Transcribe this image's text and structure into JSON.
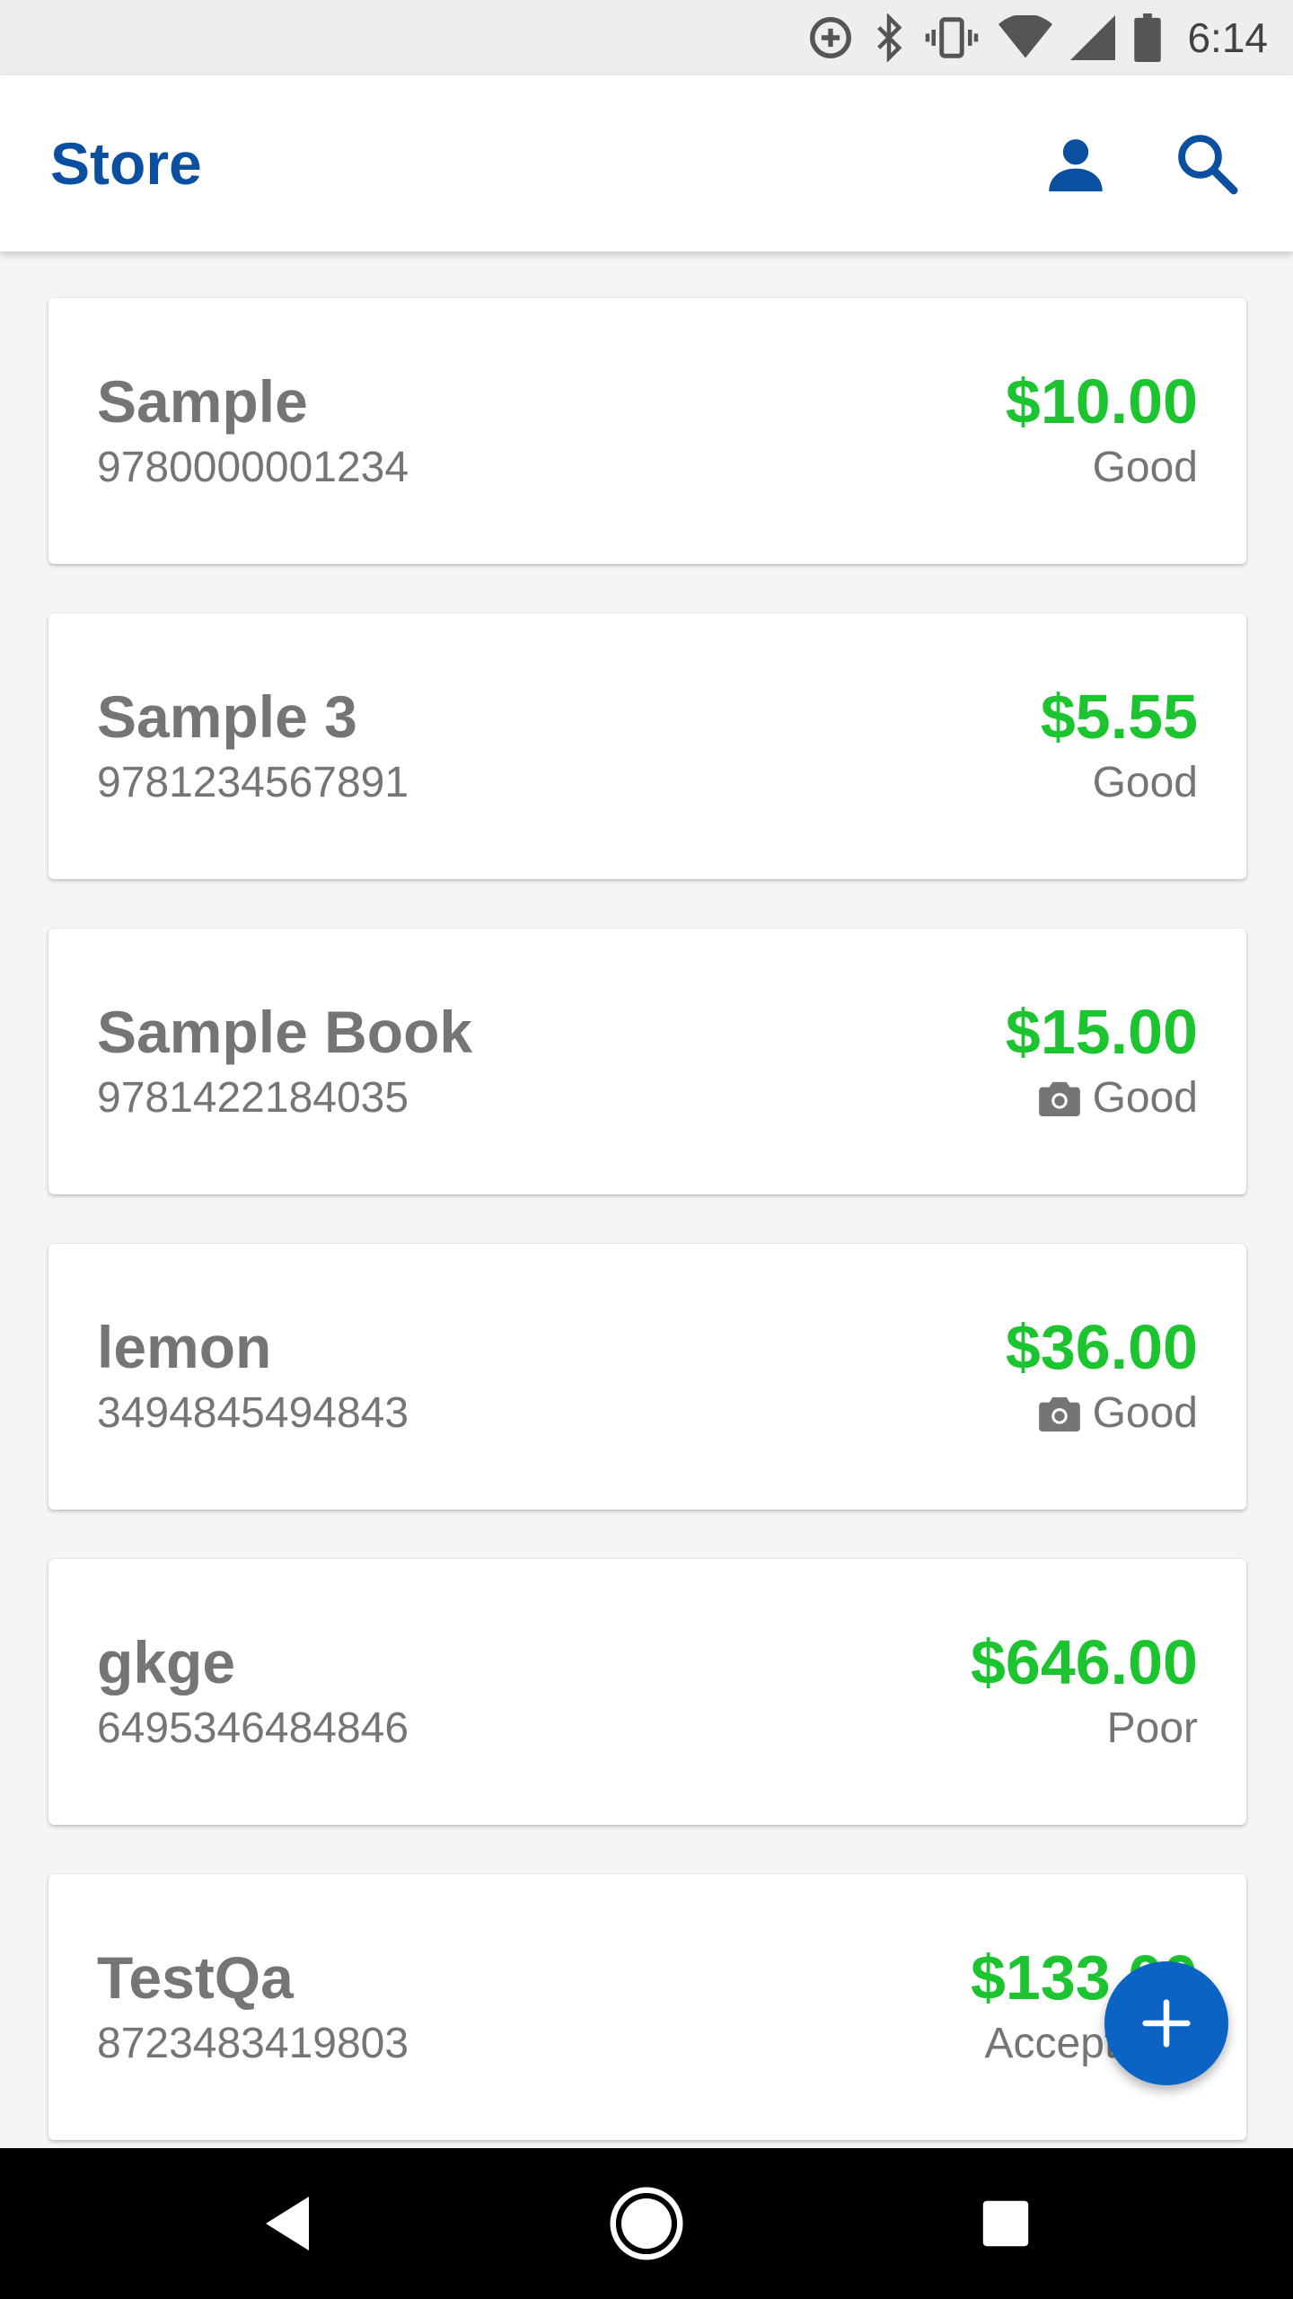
{
  "status_bar": {
    "time": "6:14",
    "icons": [
      "data-saver-icon",
      "bluetooth-icon",
      "vibrate-icon",
      "wifi-icon",
      "cell-signal-icon",
      "battery-icon"
    ]
  },
  "app_bar": {
    "title": "Store",
    "actions": [
      "account-icon",
      "search-icon"
    ]
  },
  "colors": {
    "accent": "#0b4fa0",
    "fab": "#0b63c3",
    "price": "#1cc42f",
    "text_secondary": "#757575"
  },
  "listings": [
    {
      "title": "Sample",
      "isbn": "9780000001234",
      "price": "$10.00",
      "condition": "Good",
      "has_photo": false
    },
    {
      "title": "Sample 3",
      "isbn": "9781234567891",
      "price": "$5.55",
      "condition": "Good",
      "has_photo": false
    },
    {
      "title": "Sample Book",
      "isbn": "9781422184035",
      "price": "$15.00",
      "condition": "Good",
      "has_photo": true
    },
    {
      "title": "lemon",
      "isbn": "3494845494843",
      "price": "$36.00",
      "condition": "Good",
      "has_photo": true
    },
    {
      "title": "gkge",
      "isbn": "6495346484846",
      "price": "$646.00",
      "condition": "Poor",
      "has_photo": false
    },
    {
      "title": "TestQa",
      "isbn": "8723483419803",
      "price": "$133.00",
      "condition": "Acceptable",
      "has_photo": false
    }
  ],
  "fab": {
    "icon": "plus-icon"
  },
  "nav_bar": {
    "buttons": [
      "back-icon",
      "home-icon",
      "recents-icon"
    ]
  }
}
